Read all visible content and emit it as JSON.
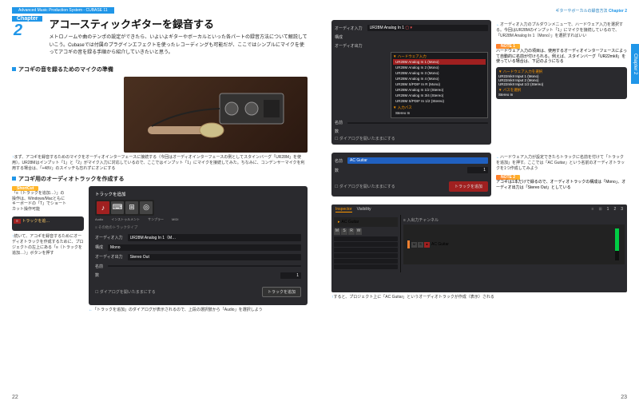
{
  "header": {
    "bar": "Advanced Music Production System - CUBASE 11",
    "chapter_label": "Chapter",
    "chapter_num": "2",
    "right_chapter": "Chapter 2",
    "right_title": "ギターやボーカルの録音方法"
  },
  "title": "アコースティックギターを録音する",
  "lead": "メトロノームや曲のテンポの設定ができたら、いよいよギターやボーカルといった各パートの録音方法について解説していこう。Cubaseでは付属のプラグインエフェクトを使ったレコーディングも可能だが、ここではシンプルにマイクを使ってアコギの音を録る手順から紹介していきたいと思う。",
  "sub1": "アコギの音を録るためのマイクの準備",
  "cap1": "まず、アコギを録音するためのマイクをオーディオインターフェースに接続する（今回はオーディオインターフェースの例としてスタインバーグ「UR28M」を使用）。UR28Mはインプット「1」と「2」がマイク入力に対応しているので、ここではインプット「1」にマイクを接続してみた。ちなみに、コンデンサーマイクを利用する場合は、「+48V」のスイッチも忘れずにオンにする",
  "sub2": "アコギ用のオーディオトラックを作成する",
  "shortcut": {
    "tag": "ShortCut",
    "text": "「≡（トラックを追加…）」の操作は、Windows/Macともにキーボードの「T」でショートカット操作可能"
  },
  "cap2": "続いて、アコギを録音するためにオーディオトラックを作成するために、プロジェクトの左上にある「≡（トラックを追加…）」ボタンを押す",
  "cap3": "「トラックを追加」のダイアログが表示されるので、上段の選択肢から「Audio」を選択しよう",
  "add_track": {
    "title": "トラックを追加",
    "tabs": [
      "Audio",
      "インストゥルメント",
      "サンプラー",
      "MIDI"
    ],
    "fields": {
      "input_label": "オーディオ入力",
      "input_value": "UR28M Analog In 1（M…",
      "config_label": "構成",
      "config_value": "Mono",
      "output_label": "オーディオ出力",
      "output_value": "Stereo Out",
      "name_label": "名前",
      "name_value": "",
      "count_label": "数",
      "count_value": "1",
      "folder_label": "≡ その他のトラックタイプ",
      "keep": "ダイアログを開いたままにする",
      "btn": "トラックを追加"
    }
  },
  "right": {
    "panel1": {
      "input": "オーディオ入力",
      "input_value": "UR28M Analog In 1",
      "output": "オーディオ出力",
      "config": "構成",
      "name": "名前",
      "count": "数",
      "keep": "ダイアログを開いたままにする",
      "options_label": "▼ ハードウェア入力",
      "options": [
        "UR28M Analog In 1 (Mono)",
        "UR28M Analog In 2 (Mono)",
        "UR28M Analog In 3 (Mono)",
        "UR28M Analog In 4 (Mono)",
        "UR28M S/PDIF In R (Mono)",
        "UR28M Analog In 1/2 (Stereo)",
        "UR28M Analog In 3/4 (Stereo)",
        "UR28M S/PDIF In 1/2 (Stereo)"
      ],
      "buses_label": "▼ 入力バス",
      "buses": "Stereo In"
    },
    "cap1": "オーディオ入力のプルダウンメニューで、ハードウェア入力を選択する。今回はUR28Mのインプット「1」にマイクを接続しているので、「UR28M Analog In 1（Mono）」を選択すればいい",
    "note1": {
      "tag": "NOTE 1",
      "text": "ハードウェア入力の項目は、使用するオーディオインターフェースによって自動的に名前が付けられる。例えば、スタインバーグ「UR22mkII」を使っている場合は、下記のようになる",
      "box": {
        "label": "▼ ハードウェア入力を選択",
        "opts": [
          "UR22mkII Input 1 (Mono)",
          "UR22mkII Input 2 (Mono)",
          "UR22mkII Input 1/2 (Stereo)"
        ],
        "bus_label": "▼ バスを選択",
        "bus": "Stereo In"
      }
    },
    "panel2": {
      "name": "名前",
      "name_value": "AC Guitar",
      "count": "数",
      "count_value": "1",
      "keep": "ダイアログを開いたままにする",
      "btn": "トラックを追加"
    },
    "cap2": "ハードウェア入力が設定できたらトラックに名前を付けて「トラックを追加」を押す。ここでは「AC Guitar」という名前のオーディオトラックを1つ作成してみよう",
    "note2": {
      "tag": "NOTE 2",
      "text": "アコギは1本だけで録るので、オーディオトラックの構成は「Mono」、オーディオ出力は「Stereo Out」としている"
    },
    "inspector": {
      "tab1": "Inspector",
      "tab2": "Visibility",
      "track": "AC Guitar",
      "channel": "入出力チャンネル",
      "numbers": [
        "1",
        "2",
        "3"
      ]
    },
    "cap3": "すると、プロジェクト上に「AC Guitar」というオーディオトラックが作成（表示）される"
  },
  "right_tab": "Chapter 2",
  "pages": {
    "left": "22",
    "right": "23"
  }
}
